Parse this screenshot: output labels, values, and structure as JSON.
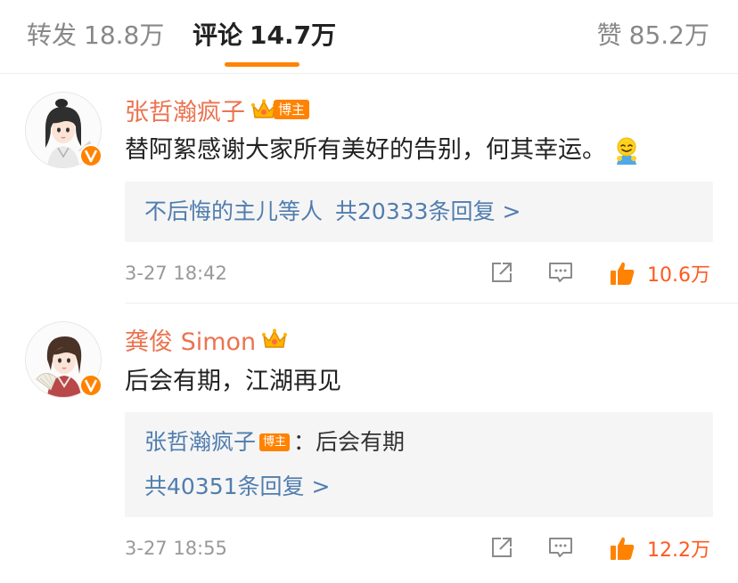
{
  "tabs": {
    "repost": {
      "label": "转发",
      "count": "18.8万"
    },
    "comments": {
      "label": "评论",
      "count": "14.7万"
    },
    "likes": {
      "label": "赞",
      "count": "85.2万"
    }
  },
  "colors": {
    "accent": "#ff8200",
    "username": "#eb7350",
    "link": "#507daf",
    "like": "#ff5a1f"
  },
  "comments": [
    {
      "username": "张哲瀚疯子",
      "badge": "博主",
      "text": "替阿絮感谢大家所有美好的告别，何其幸运。",
      "emoji": "smile-emoji",
      "reply_summary": {
        "names": "不后悔的主儿等人",
        "total": "共20333条回复 >"
      },
      "timestamp": "3-27 18:42",
      "likes": "10.6万",
      "icons": [
        "crown-icon",
        "verified-badge-icon"
      ]
    },
    {
      "username": "龚俊 Simon",
      "text": "后会有期，江湖再见",
      "reply_summary": {
        "first_reply_author": "张哲瀚疯子",
        "first_reply_badge": "博主",
        "first_reply_text": "：后会有期",
        "total": "共40351条回复 >"
      },
      "timestamp": "3-27 18:55",
      "likes": "12.2万",
      "icons": [
        "crown-icon",
        "verified-badge-icon"
      ]
    }
  ]
}
